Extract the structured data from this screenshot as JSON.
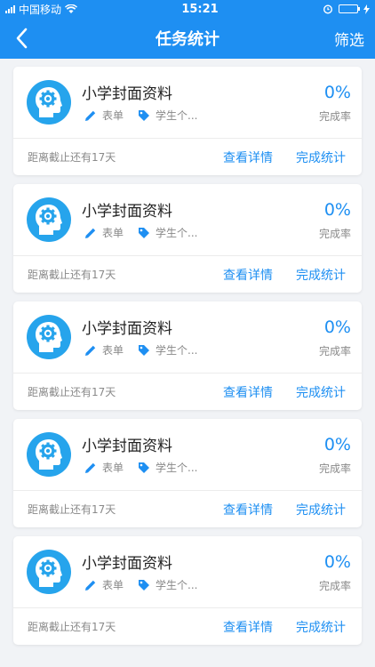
{
  "status_bar": {
    "carrier": "中国移动",
    "time": "15:21",
    "icons": [
      "signal-icon",
      "wifi-icon",
      "alarm-icon",
      "battery-icon",
      "charging-icon"
    ]
  },
  "nav": {
    "back_icon": "chevron-left-icon",
    "title": "任务统计",
    "filter_label": "筛选"
  },
  "colors": {
    "primary": "#1e8ff2",
    "avatar_bg": "#26a4ec",
    "battery": "#46e06a"
  },
  "tasks": [
    {
      "title": "小学封面资料",
      "type_label": "表单",
      "tag_label": "学生个...",
      "percent": "0%",
      "rate_label": "完成率",
      "deadline": "距离截止还有17天",
      "view_label": "查看详情",
      "stats_label": "完成统计"
    },
    {
      "title": "小学封面资料",
      "type_label": "表单",
      "tag_label": "学生个...",
      "percent": "0%",
      "rate_label": "完成率",
      "deadline": "距离截止还有17天",
      "view_label": "查看详情",
      "stats_label": "完成统计"
    },
    {
      "title": "小学封面资料",
      "type_label": "表单",
      "tag_label": "学生个...",
      "percent": "0%",
      "rate_label": "完成率",
      "deadline": "距离截止还有17天",
      "view_label": "查看详情",
      "stats_label": "完成统计"
    },
    {
      "title": "小学封面资料",
      "type_label": "表单",
      "tag_label": "学生个...",
      "percent": "0%",
      "rate_label": "完成率",
      "deadline": "距离截止还有17天",
      "view_label": "查看详情",
      "stats_label": "完成统计"
    },
    {
      "title": "小学封面资料",
      "type_label": "表单",
      "tag_label": "学生个...",
      "percent": "0%",
      "rate_label": "完成率",
      "deadline": "距离截止还有17天",
      "view_label": "查看详情",
      "stats_label": "完成统计"
    }
  ]
}
